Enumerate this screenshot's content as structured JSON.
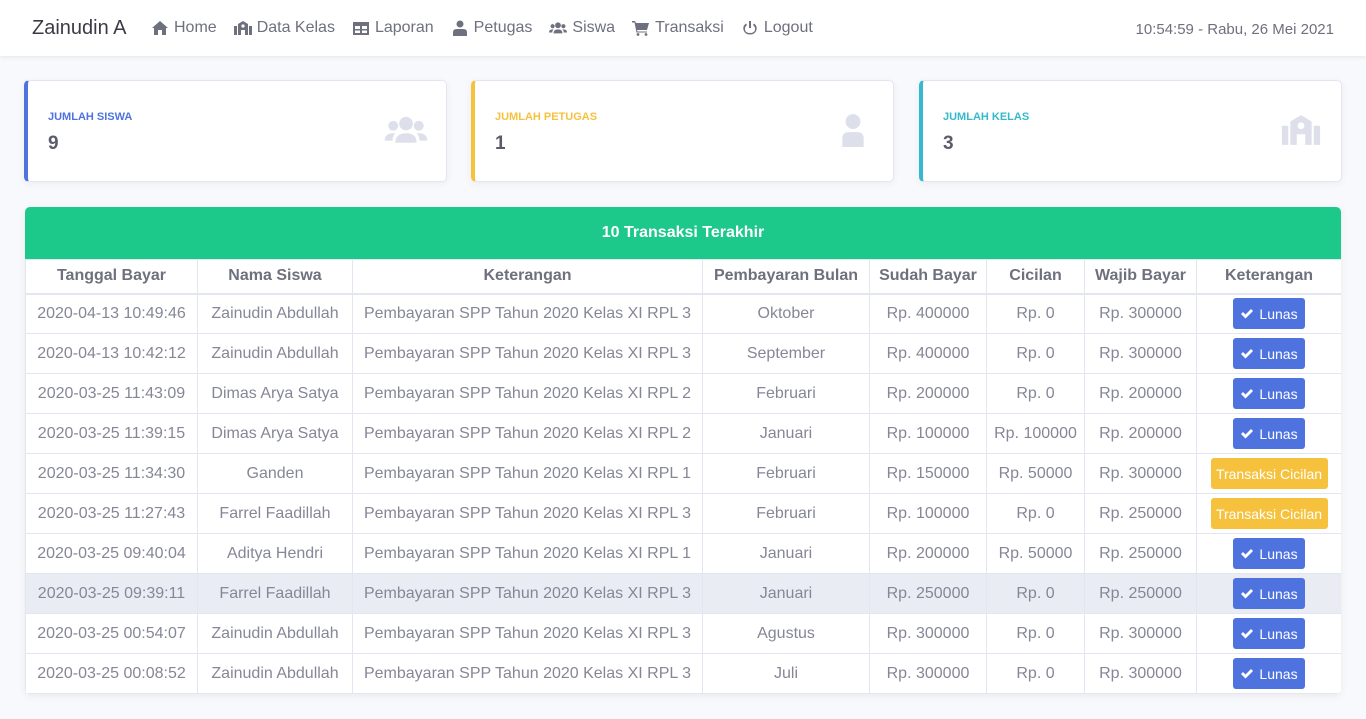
{
  "brand": "Zainudin A",
  "nav": [
    {
      "label": "Home",
      "icon": "home-icon"
    },
    {
      "label": "Data Kelas",
      "icon": "school-icon"
    },
    {
      "label": "Laporan",
      "icon": "table-icon"
    },
    {
      "label": "Petugas",
      "icon": "user-tie-icon"
    },
    {
      "label": "Siswa",
      "icon": "users-icon"
    },
    {
      "label": "Transaksi",
      "icon": "cart-icon"
    },
    {
      "label": "Logout",
      "icon": "power-icon"
    }
  ],
  "clock": "10:54:59 - Rabu, 26 Mei 2021",
  "cards": [
    {
      "label": "Jumlah Siswa",
      "value": "9",
      "color": "#4e73df",
      "icon": "users-icon"
    },
    {
      "label": "Jumlah Petugas",
      "value": "1",
      "color": "#f6c23e",
      "icon": "user-tie-icon"
    },
    {
      "label": "Jumlah Kelas",
      "value": "3",
      "color": "#36b9cc",
      "icon": "school-icon"
    }
  ],
  "panel": {
    "title": "10 Transaksi Terakhir",
    "header_color": "#1cc88a",
    "columns": [
      "Tanggal Bayar",
      "Nama Siswa",
      "Keterangan",
      "Pembayaran Bulan",
      "Sudah Bayar",
      "Cicilan",
      "Wajib Bayar",
      "Keterangan"
    ],
    "rows": [
      {
        "tanggal": "2020-04-13 10:49:46",
        "nama": "Zainudin Abdullah",
        "ket": "Pembayaran SPP Tahun 2020 Kelas XI RPL 3",
        "bulan": "Oktober",
        "sudah": "Rp. 400000",
        "cicilan": "Rp. 0",
        "wajib": "Rp. 300000",
        "status": "Lunas",
        "kind": "lunas"
      },
      {
        "tanggal": "2020-04-13 10:42:12",
        "nama": "Zainudin Abdullah",
        "ket": "Pembayaran SPP Tahun 2020 Kelas XI RPL 3",
        "bulan": "September",
        "sudah": "Rp. 400000",
        "cicilan": "Rp. 0",
        "wajib": "Rp. 300000",
        "status": "Lunas",
        "kind": "lunas"
      },
      {
        "tanggal": "2020-03-25 11:43:09",
        "nama": "Dimas Arya Satya",
        "ket": "Pembayaran SPP Tahun 2020 Kelas XI RPL 2",
        "bulan": "Februari",
        "sudah": "Rp. 200000",
        "cicilan": "Rp. 0",
        "wajib": "Rp. 200000",
        "status": "Lunas",
        "kind": "lunas"
      },
      {
        "tanggal": "2020-03-25 11:39:15",
        "nama": "Dimas Arya Satya",
        "ket": "Pembayaran SPP Tahun 2020 Kelas XI RPL 2",
        "bulan": "Januari",
        "sudah": "Rp. 100000",
        "cicilan": "Rp. 100000",
        "wajib": "Rp. 200000",
        "status": "Lunas",
        "kind": "lunas"
      },
      {
        "tanggal": "2020-03-25 11:34:30",
        "nama": "Ganden",
        "ket": "Pembayaran SPP Tahun 2020 Kelas XI RPL 1",
        "bulan": "Februari",
        "sudah": "Rp. 150000",
        "cicilan": "Rp. 50000",
        "wajib": "Rp. 300000",
        "status": "Transaksi Cicilan",
        "kind": "cicil"
      },
      {
        "tanggal": "2020-03-25 11:27:43",
        "nama": "Farrel Faadillah",
        "ket": "Pembayaran SPP Tahun 2020 Kelas XI RPL 3",
        "bulan": "Februari",
        "sudah": "Rp. 100000",
        "cicilan": "Rp. 0",
        "wajib": "Rp. 250000",
        "status": "Transaksi Cicilan",
        "kind": "cicil"
      },
      {
        "tanggal": "2020-03-25 09:40:04",
        "nama": "Aditya Hendri",
        "ket": "Pembayaran SPP Tahun 2020 Kelas XI RPL 1",
        "bulan": "Januari",
        "sudah": "Rp. 200000",
        "cicilan": "Rp. 50000",
        "wajib": "Rp. 250000",
        "status": "Lunas",
        "kind": "lunas"
      },
      {
        "tanggal": "2020-03-25 09:39:11",
        "nama": "Farrel Faadillah",
        "ket": "Pembayaran SPP Tahun 2020 Kelas XI RPL 3",
        "bulan": "Januari",
        "sudah": "Rp. 250000",
        "cicilan": "Rp. 0",
        "wajib": "Rp. 250000",
        "status": "Lunas",
        "kind": "lunas"
      },
      {
        "tanggal": "2020-03-25 00:54:07",
        "nama": "Zainudin Abdullah",
        "ket": "Pembayaran SPP Tahun 2020 Kelas XI RPL 3",
        "bulan": "Agustus",
        "sudah": "Rp. 300000",
        "cicilan": "Rp. 0",
        "wajib": "Rp. 300000",
        "status": "Lunas",
        "kind": "lunas"
      },
      {
        "tanggal": "2020-03-25 00:08:52",
        "nama": "Zainudin Abdullah",
        "ket": "Pembayaran SPP Tahun 2020 Kelas XI RPL 3",
        "bulan": "Juli",
        "sudah": "Rp. 300000",
        "cicilan": "Rp. 0",
        "wajib": "Rp. 300000",
        "status": "Lunas",
        "kind": "lunas"
      }
    ]
  }
}
